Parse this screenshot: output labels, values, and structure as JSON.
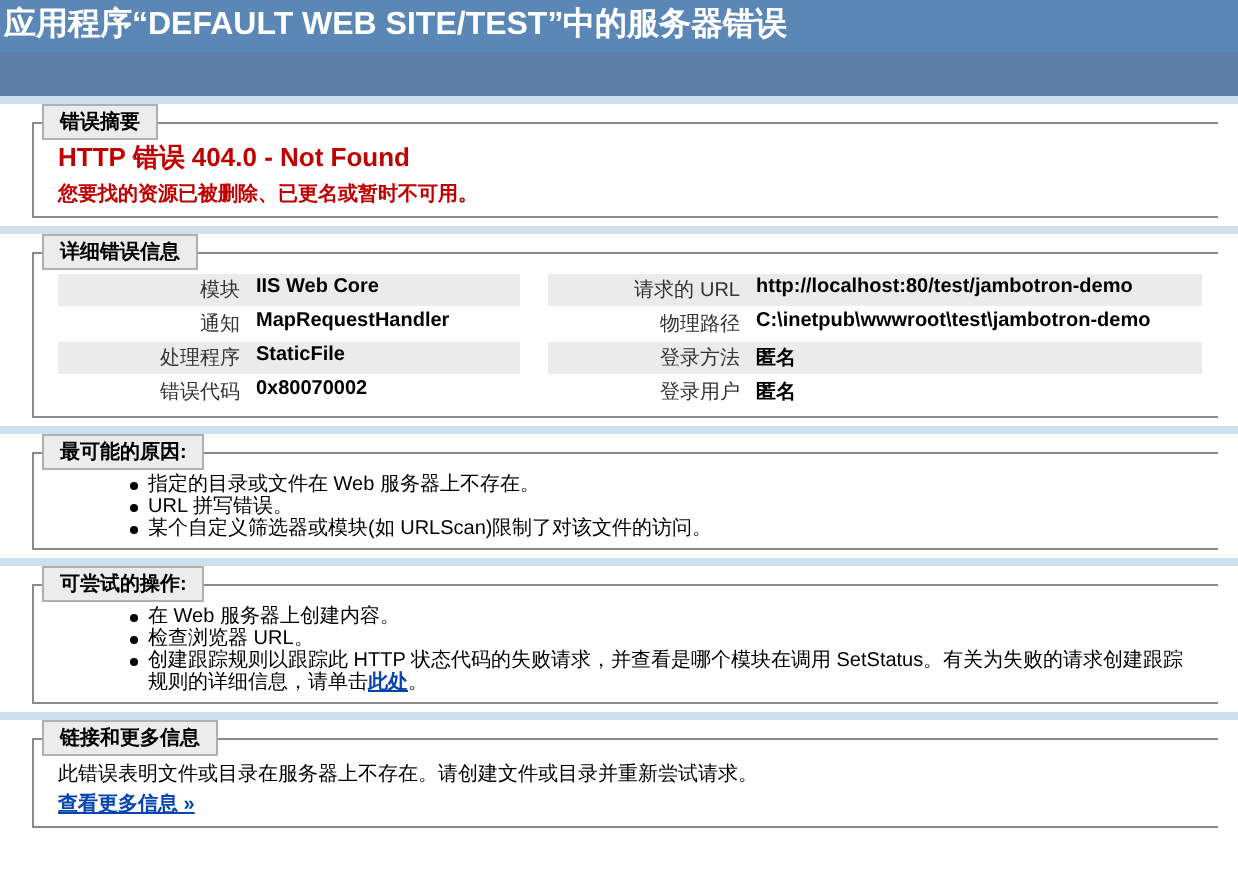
{
  "window": {
    "title": "应用程序“DEFAULT WEB SITE/TEST”中的服务器错误"
  },
  "sections": [
    {
      "kind": "summary",
      "legend": "错误摘要",
      "heading": "HTTP 错误 404.0 - Not Found",
      "message": "您要找的资源已被删除、已更名或暂时不可用。"
    },
    {
      "kind": "details",
      "legend": "详细错误信息",
      "rows": [
        {
          "left_label": "模块",
          "left_value": "IIS Web Core",
          "right_label": "请求的 URL",
          "right_value": "http://localhost:80/test/jambotron-demo"
        },
        {
          "left_label": "通知",
          "left_value": "MapRequestHandler",
          "right_label": "物理路径",
          "right_value": "C:\\inetpub\\wwwroot\\test\\jambotron-demo"
        },
        {
          "left_label": "处理程序",
          "left_value": "StaticFile",
          "right_label": "登录方法",
          "right_value": "匿名"
        },
        {
          "left_label": "错误代码",
          "left_value": "0x80070002",
          "right_label": "登录用户",
          "right_value": "匿名"
        }
      ]
    },
    {
      "kind": "list",
      "legend": "最可能的原因:",
      "items": [
        {
          "text": "指定的目录或文件在 Web 服务器上不存在。"
        },
        {
          "text": "URL 拼写错误。"
        },
        {
          "text": "某个自定义筛选器或模块(如 URLScan)限制了对该文件的访问。"
        }
      ]
    },
    {
      "kind": "list",
      "legend": "可尝试的操作:",
      "items": [
        {
          "text": "在 Web 服务器上创建内容。"
        },
        {
          "text": "检查浏览器 URL。"
        },
        {
          "text": "创建跟踪规则以跟踪此 HTTP 状态代码的失败请求，并查看是哪个模块在调用 SetStatus。有关为失败的请求创建跟踪规则的详细信息，请单击",
          "link": "此处",
          "tail": "。"
        }
      ]
    },
    {
      "kind": "info",
      "legend": "链接和更多信息",
      "text": "此错误表明文件或目录在服务器上不存在。请创建文件或目录并重新尝试请求。",
      "link": "查看更多信息 »"
    }
  ]
}
